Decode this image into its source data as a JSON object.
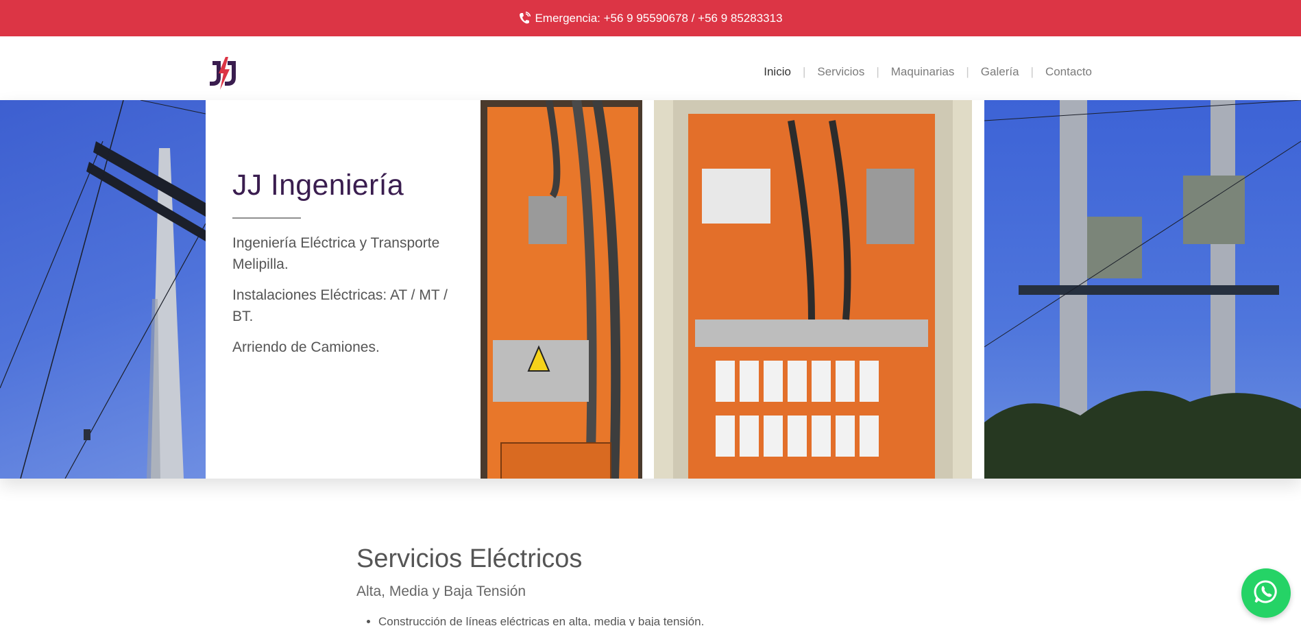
{
  "topbar": {
    "text": "Emergencia: +56 9 95590678 / +56 9 85283313",
    "icon": "phone-volume-icon",
    "bg": "#dc3545"
  },
  "header": {
    "logo": {
      "icon": "jj-logo"
    },
    "nav": [
      {
        "label": "Inicio",
        "active": true
      },
      {
        "label": "Servicios"
      },
      {
        "label": "Maquinarias"
      },
      {
        "label": "Galería"
      },
      {
        "label": "Contacto"
      }
    ],
    "separator": "|"
  },
  "hero": {
    "title": "JJ Ingeniería",
    "paragraphs": [
      "Ingeniería Eléctrica y Transporte Melipilla.",
      "Instalaciones Eléctricas: AT / MT / BT.",
      "Arriendo de Camiones."
    ],
    "title_color": "#3a1d4f"
  },
  "services": {
    "title": "Servicios Eléctricos",
    "subtitle": "Alta, Media y Baja Tensión",
    "items": [
      "Construcción de líneas eléctricas en alta, media y baja tensión."
    ]
  },
  "whatsapp": {
    "icon": "whatsapp-icon",
    "color": "#25d366"
  }
}
